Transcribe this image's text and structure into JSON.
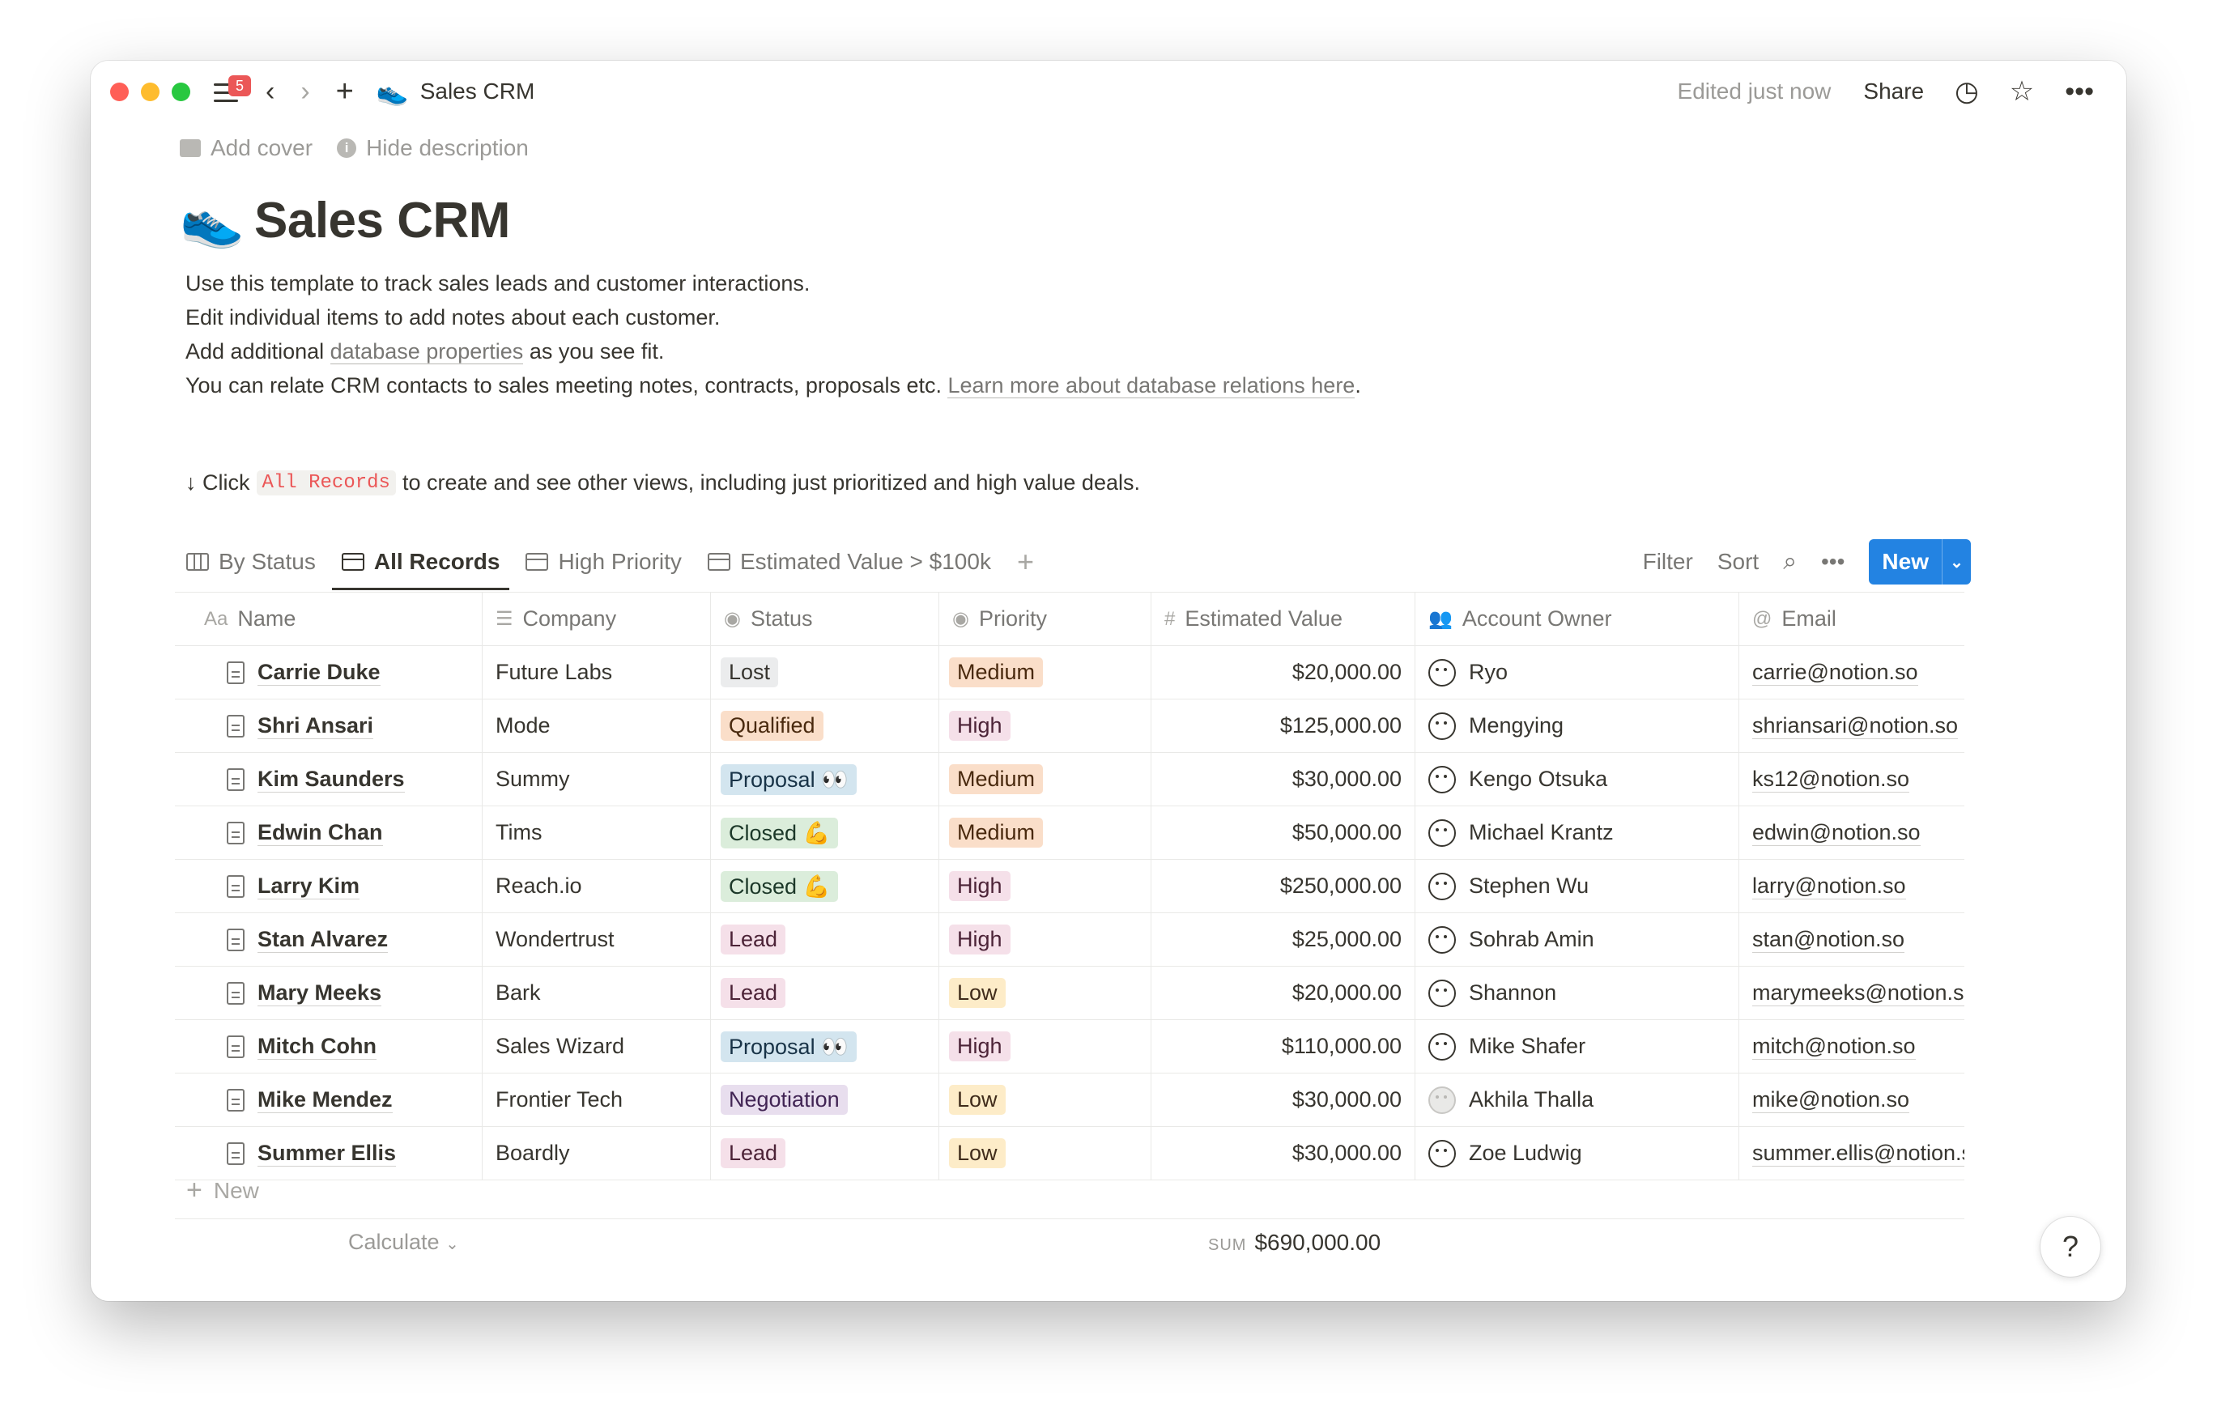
{
  "titlebar": {
    "badge_count": "5",
    "page_emoji": "👟",
    "title": "Sales CRM",
    "edited": "Edited just now",
    "share": "Share"
  },
  "page": {
    "add_cover": "Add cover",
    "hide_description": "Hide description",
    "emoji": "👟",
    "title": "Sales CRM",
    "desc_line1": "Use this template to track sales leads and customer interactions.",
    "desc_line2": "Edit individual items to add notes about each customer.",
    "desc_line3_pre": "Add additional ",
    "desc_line3_link": "database properties",
    "desc_line3_post": " as you see fit.",
    "desc_line4_pre": "You can relate CRM contacts to sales meeting notes, contracts, proposals etc. ",
    "desc_line4_link": "Learn more about database relations here",
    "desc_line4_post": ".",
    "click_pre": "↓ Click",
    "click_code": "All Records",
    "click_post": "to create and see other views, including just prioritized and high value deals."
  },
  "tabs": [
    {
      "label": "By Status",
      "icon": "board-icon"
    },
    {
      "label": "All Records",
      "icon": "table-icon",
      "active": true
    },
    {
      "label": "High Priority",
      "icon": "table-icon"
    },
    {
      "label": "Estimated Value > $100k",
      "icon": "table-icon"
    }
  ],
  "view_actions": {
    "filter": "Filter",
    "sort": "Sort",
    "new": "New"
  },
  "columns": {
    "name_icon": "Aa",
    "name": "Name",
    "company": "Company",
    "status": "Status",
    "priority": "Priority",
    "value_icon": "#",
    "value": "Estimated Value",
    "owner": "Account Owner",
    "email_icon": "@",
    "email": "Email"
  },
  "tag_colors": {
    "Lost": {
      "bg": "#ebeced",
      "fg": "#37352f"
    },
    "Qualified": {
      "bg": "#fadec9",
      "fg": "#49290e"
    },
    "Proposal 👀": {
      "bg": "#d3e5ef",
      "fg": "#183347"
    },
    "Closed 💪": {
      "bg": "#dbeddb",
      "fg": "#1c3829"
    },
    "Lead": {
      "bg": "#f5e0e9",
      "fg": "#4c2337"
    },
    "Negotiation": {
      "bg": "#e8deee",
      "fg": "#412454"
    },
    "Medium": {
      "bg": "#fadec9",
      "fg": "#49290e"
    },
    "High": {
      "bg": "#f5e0e9",
      "fg": "#4c2337"
    },
    "Low": {
      "bg": "#fdecc8",
      "fg": "#402c1b"
    }
  },
  "rows": [
    {
      "name": "Carrie Duke",
      "company": "Future Labs",
      "status": "Lost",
      "priority": "Medium",
      "value": "$20,000.00",
      "owner": "Ryo",
      "email": "carrie@notion.so"
    },
    {
      "name": "Shri Ansari",
      "company": "Mode",
      "status": "Qualified",
      "priority": "High",
      "value": "$125,000.00",
      "owner": "Mengying",
      "email": "shriansari@notion.so"
    },
    {
      "name": "Kim Saunders",
      "company": "Summy",
      "status": "Proposal 👀",
      "priority": "Medium",
      "value": "$30,000.00",
      "owner": "Kengo Otsuka",
      "email": "ks12@notion.so"
    },
    {
      "name": "Edwin Chan",
      "company": "Tims",
      "status": "Closed 💪",
      "priority": "Medium",
      "value": "$50,000.00",
      "owner": "Michael Krantz",
      "email": "edwin@notion.so"
    },
    {
      "name": "Larry Kim",
      "company": "Reach.io",
      "status": "Closed 💪",
      "priority": "High",
      "value": "$250,000.00",
      "owner": "Stephen Wu",
      "email": "larry@notion.so"
    },
    {
      "name": "Stan Alvarez",
      "company": "Wondertrust",
      "status": "Lead",
      "priority": "High",
      "value": "$25,000.00",
      "owner": "Sohrab Amin",
      "email": "stan@notion.so"
    },
    {
      "name": "Mary Meeks",
      "company": "Bark",
      "status": "Lead",
      "priority": "Low",
      "value": "$20,000.00",
      "owner": "Shannon",
      "email": "marymeeks@notion.so"
    },
    {
      "name": "Mitch Cohn",
      "company": "Sales Wizard",
      "status": "Proposal 👀",
      "priority": "High",
      "value": "$110,000.00",
      "owner": "Mike Shafer",
      "email": "mitch@notion.so"
    },
    {
      "name": "Mike Mendez",
      "company": "Frontier Tech",
      "status": "Negotiation",
      "priority": "Low",
      "value": "$30,000.00",
      "owner": "Akhila Thalla",
      "email": "mike@notion.so",
      "owner_gray": true
    },
    {
      "name": "Summer Ellis",
      "company": "Boardly",
      "status": "Lead",
      "priority": "Low",
      "value": "$30,000.00",
      "owner": "Zoe Ludwig",
      "email": "summer.ellis@notion.so"
    }
  ],
  "footer": {
    "new_label": "New",
    "calculate": "Calculate",
    "sum_label": "SUM",
    "sum_value": "$690,000.00",
    "help": "?"
  }
}
